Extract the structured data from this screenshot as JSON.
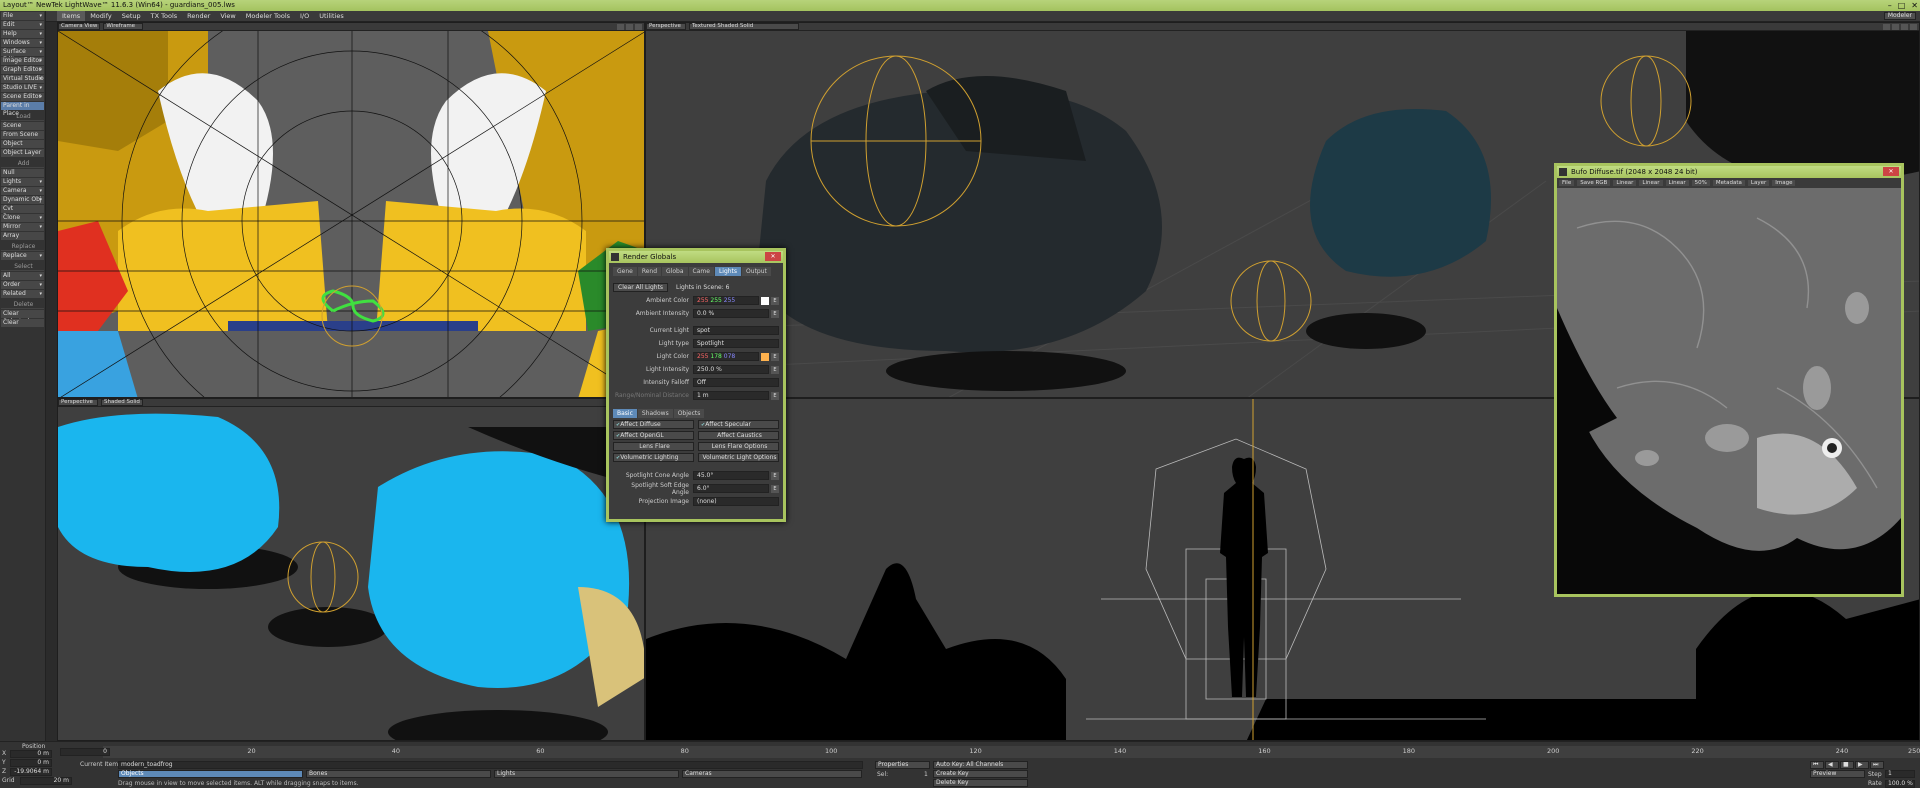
{
  "window": {
    "title": "Layout™ NewTek LightWave™ 11.6.3 (Win64) - guardians_005.lws"
  },
  "menu": {
    "left_label": "File",
    "tabs": [
      "Items",
      "Modify",
      "Setup",
      "TX Tools",
      "Render",
      "View",
      "Modeler Tools",
      "I/O",
      "Utilities"
    ],
    "active_tab": "Items",
    "modeler_label": "Modeler"
  },
  "sidebar": {
    "top": [
      "File",
      "Edit",
      "Help",
      "Windows",
      "Surface Editor",
      "Image Editor",
      "Graph Editor",
      "Virtual Studio",
      "Studio LIVE",
      "Scene Editor",
      "Parent in Place"
    ],
    "load_head": "Load",
    "load": [
      "Scene",
      "From Scene",
      "Object",
      "Object Layer"
    ],
    "add_head": "Add",
    "add": [
      "Null",
      "Lights",
      "Camera",
      "Dynamic Obj",
      "Cvt Powergons",
      "Clone",
      "Mirror",
      "Array"
    ],
    "replace_head": "Replace",
    "replace": [
      "Replace"
    ],
    "select_head": "Select",
    "select": [
      "All",
      "Order",
      "Related"
    ],
    "delete_head": "Delete",
    "delete": [
      "Clear Selected",
      "Clear"
    ]
  },
  "viewports": {
    "top_left": {
      "view": "Camera View",
      "mode": "Wireframe"
    },
    "top_right": {
      "view": "Perspective",
      "mode": "Textured Shaded Solid"
    },
    "bottom_left": {
      "view": "Perspective",
      "mode": "Shaded Solid"
    }
  },
  "render_globals": {
    "title": "Render Globals",
    "tabs": [
      "Gene",
      "Rend",
      "Globa",
      "Came",
      "Lights",
      "Output"
    ],
    "active_tab": "Lights",
    "clear_all": "Clear All Lights",
    "lights_in_scene": "Lights in Scene: 6",
    "ambient_color_label": "Ambient Color",
    "ambient_color": [
      "255",
      "255",
      "255"
    ],
    "ambient_intensity_label": "Ambient Intensity",
    "ambient_intensity": "0.0 %",
    "current_light_label": "Current Light",
    "current_light": "spot",
    "light_type_label": "Light type",
    "light_type": "Spotlight",
    "light_color_label": "Light Color",
    "light_color": [
      "255",
      "178",
      "078"
    ],
    "light_intensity_label": "Light Intensity",
    "light_intensity": "250.0 %",
    "falloff_label": "Intensity Falloff",
    "falloff": "Off",
    "range_label": "Range/Nominal Distance",
    "range": "1 m",
    "subtabs": [
      "Basic",
      "Shadows",
      "Objects"
    ],
    "active_subtab": "Basic",
    "checks": [
      {
        "label": "Affect Diffuse",
        "on": true
      },
      {
        "label": "Affect Specular",
        "on": true
      },
      {
        "label": "Affect OpenGL",
        "on": true
      },
      {
        "label": "Affect Caustics",
        "on": false
      },
      {
        "label": "Lens Flare",
        "on": false
      },
      {
        "label": "Lens Flare Options",
        "on": false
      },
      {
        "label": "Volumetric Lighting",
        "on": true
      },
      {
        "label": "Volumetric Light Options",
        "on": false
      }
    ],
    "cone_label": "Spotlight Cone Angle",
    "cone": "45.0°",
    "edge_label": "Spotlight Soft Edge Angle",
    "edge": "6.0°",
    "proj_label": "Projection Image",
    "proj": "(none)"
  },
  "image_window": {
    "title": "Bufo Diffuse.tif (2048 x 2048 24 bit)",
    "toolbar": [
      "File",
      "Save RGB",
      "Linear",
      "Linear",
      "Linear",
      "50%",
      "Metadata",
      "Layer",
      "Image"
    ]
  },
  "timeline": {
    "position_label": "Position",
    "x_val": "0 m",
    "y_val": "0 m",
    "z_val": "-19.9064 m",
    "grid_label": "Grid",
    "grid_val": "20 m",
    "frame_start": "0",
    "ticks": [
      "0",
      "20",
      "40",
      "60",
      "80",
      "100",
      "120",
      "140",
      "160",
      "180",
      "200",
      "220",
      "240",
      "250"
    ],
    "current_item_label": "Current Item",
    "current_item": "modern_toadfrog",
    "objects": "Objects",
    "bones": "Bones",
    "lights": "Lights",
    "cameras": "Cameras",
    "properties": "Properties",
    "sel_label": "Sel:",
    "sel_val": "1",
    "auto_key": "Auto Key: All Channels",
    "create_key": "Create Key",
    "delete_key": "Delete Key",
    "preview": "Preview",
    "step_label": "Step",
    "step_val": "1",
    "rate_label": "Rate",
    "rate_val": "100.0 %",
    "status": "Drag mouse in view to move selected items. ALT while dragging snaps to items."
  }
}
